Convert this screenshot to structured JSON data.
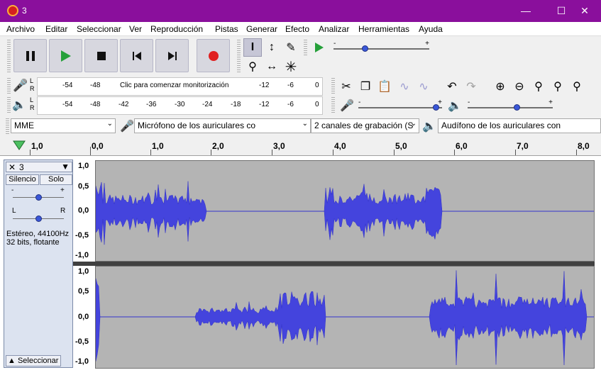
{
  "window": {
    "title": "3"
  },
  "menu": [
    "Archivo",
    "Editar",
    "Seleccionar",
    "Ver",
    "Reproducción",
    "Pistas",
    "Generar",
    "Efecto",
    "Analizar",
    "Herramientas",
    "Ayuda"
  ],
  "transport": {
    "icons": [
      "pause-icon",
      "play-icon",
      "stop-icon",
      "skip-start-icon",
      "skip-end-icon",
      "record-icon"
    ]
  },
  "record_meter": {
    "prompt": "Clic para comenzar monitorización",
    "ticks": [
      "-54",
      "-48",
      "-12",
      "-6",
      "0"
    ]
  },
  "play_meter": {
    "ticks": [
      "-54",
      "-48",
      "-42",
      "-36",
      "-30",
      "-24",
      "-18",
      "-12",
      "-6",
      "0"
    ]
  },
  "channels": {
    "left": "L",
    "right": "R"
  },
  "device": {
    "host": "MME",
    "recording": "Micrófono de los auriculares co",
    "channels": "2 canales de grabación (S",
    "playback": "Audífono de los auriculares con"
  },
  "ruler": {
    "labels": [
      "1,0",
      "0,0",
      "1,0",
      "2,0",
      "3,0",
      "4,0",
      "5,0",
      "6,0",
      "7,0",
      "8,0"
    ]
  },
  "track": {
    "name": "3",
    "mute": "Silencio",
    "solo": "Solo",
    "gain_minus": "-",
    "gain_plus": "+",
    "pan_left": "L",
    "pan_right": "R",
    "format_line1": "Estéreo, 44100Hz",
    "format_line2": "32 bits, flotante",
    "select": "Seleccionar"
  },
  "vscale": [
    "1,0",
    "0,5",
    "0,0",
    "-0,5",
    "-1,0"
  ],
  "colors": {
    "titlebar": "#8a0f9c",
    "waveform": "#3c3cd8",
    "track_bg": "#b4b4b4",
    "record": "#e02020"
  },
  "playback_gain_fraction": 0.82,
  "playback_speed_fraction": 0.27,
  "recording_volume_fraction": 0.82
}
